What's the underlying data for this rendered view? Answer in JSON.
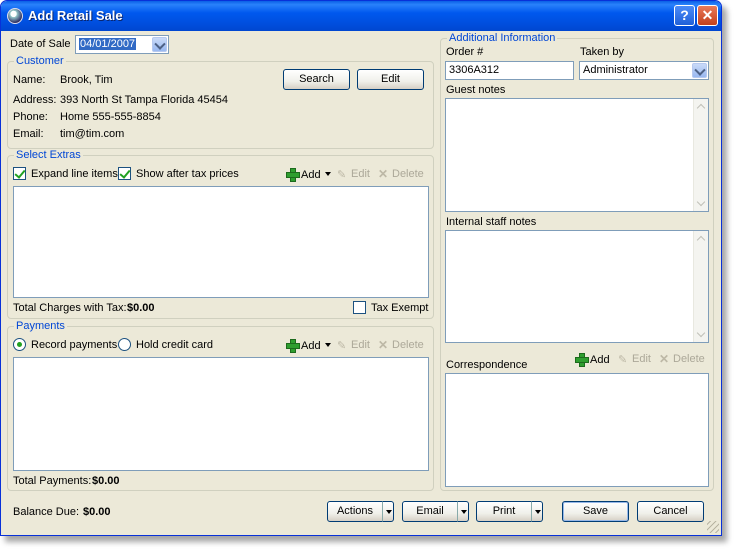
{
  "window": {
    "title": "Add Retail Sale",
    "help_label": "?",
    "close_label": "✕"
  },
  "date_of_sale": {
    "label": "Date of Sale",
    "value": "04/01/2007"
  },
  "customer": {
    "legend": "Customer",
    "name_label": "Name:",
    "name_value": "Brook, Tim",
    "address_label": "Address:",
    "address_value": "393 North St Tampa Florida 45454",
    "phone_label": "Phone:",
    "phone_value": "Home 555-555-8854",
    "email_label": "Email:",
    "email_value": "tim@tim.com",
    "search_button": "Search",
    "edit_button": "Edit"
  },
  "extras": {
    "legend": "Select Extras",
    "expand_label": "Expand line items",
    "expand_checked": true,
    "after_tax_label": "Show after tax prices",
    "after_tax_checked": true,
    "add_label": "Add",
    "edit_label": "Edit",
    "delete_label": "Delete",
    "total_label": "Total Charges with Tax:",
    "total_value": "$0.00",
    "tax_exempt_label": "Tax Exempt",
    "tax_exempt_checked": false
  },
  "payments": {
    "legend": "Payments",
    "record_label": "Record payments",
    "record_selected": true,
    "hold_label": "Hold credit card",
    "add_label": "Add",
    "edit_label": "Edit",
    "delete_label": "Delete",
    "total_label": "Total Payments:",
    "total_value": "$0.00"
  },
  "balance": {
    "label": "Balance Due:",
    "value": "$0.00"
  },
  "additional": {
    "legend": "Additional Information",
    "order_label": "Order #",
    "order_value": "3306A312",
    "taken_by_label": "Taken by",
    "taken_by_value": "Administrator",
    "guest_notes_label": "Guest notes",
    "staff_notes_label": "Internal staff notes",
    "correspondence_label": "Correspondence",
    "add_label": "Add",
    "edit_label": "Edit",
    "delete_label": "Delete"
  },
  "footer": {
    "actions_label": "Actions",
    "email_label": "Email",
    "print_label": "Print",
    "save_label": "Save",
    "cancel_label": "Cancel"
  }
}
